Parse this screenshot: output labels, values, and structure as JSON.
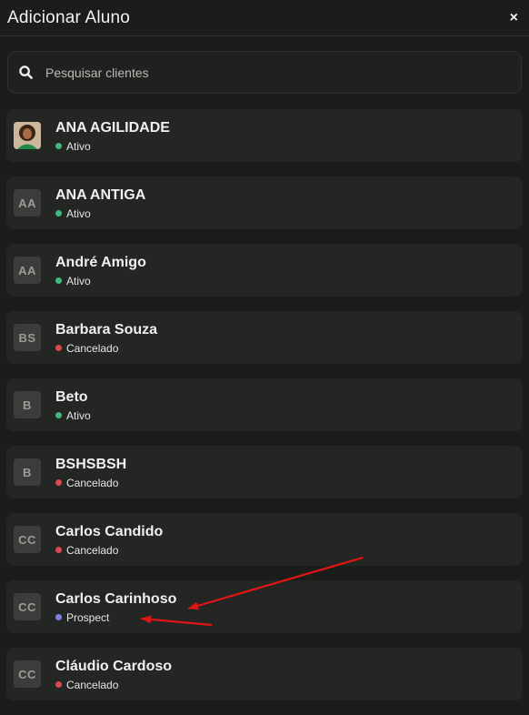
{
  "header": {
    "title": "Adicionar Aluno",
    "close_label": "×"
  },
  "search": {
    "placeholder": "Pesquisar clientes",
    "value": ""
  },
  "status_colors": {
    "Ativo": "#3dbb7b",
    "Cancelado": "#e0474c",
    "Prospect": "#7d7fe8"
  },
  "clients": [
    {
      "name": "ANA AGILIDADE",
      "initials": "",
      "photo": true,
      "status": "Ativo"
    },
    {
      "name": "ANA ANTIGA",
      "initials": "AA",
      "photo": false,
      "status": "Ativo"
    },
    {
      "name": "André Amigo",
      "initials": "AA",
      "photo": false,
      "status": "Ativo"
    },
    {
      "name": "Barbara Souza",
      "initials": "BS",
      "photo": false,
      "status": "Cancelado"
    },
    {
      "name": "Beto",
      "initials": "B",
      "photo": false,
      "status": "Ativo"
    },
    {
      "name": "BSHSBSH",
      "initials": "B",
      "photo": false,
      "status": "Cancelado"
    },
    {
      "name": "Carlos Candido",
      "initials": "CC",
      "photo": false,
      "status": "Cancelado"
    },
    {
      "name": "Carlos Carinhoso",
      "initials": "CC",
      "photo": false,
      "status": "Prospect"
    },
    {
      "name": "Cláudio Cardoso",
      "initials": "CC",
      "photo": false,
      "status": "Cancelado"
    }
  ],
  "annotation_color": "#e01515"
}
